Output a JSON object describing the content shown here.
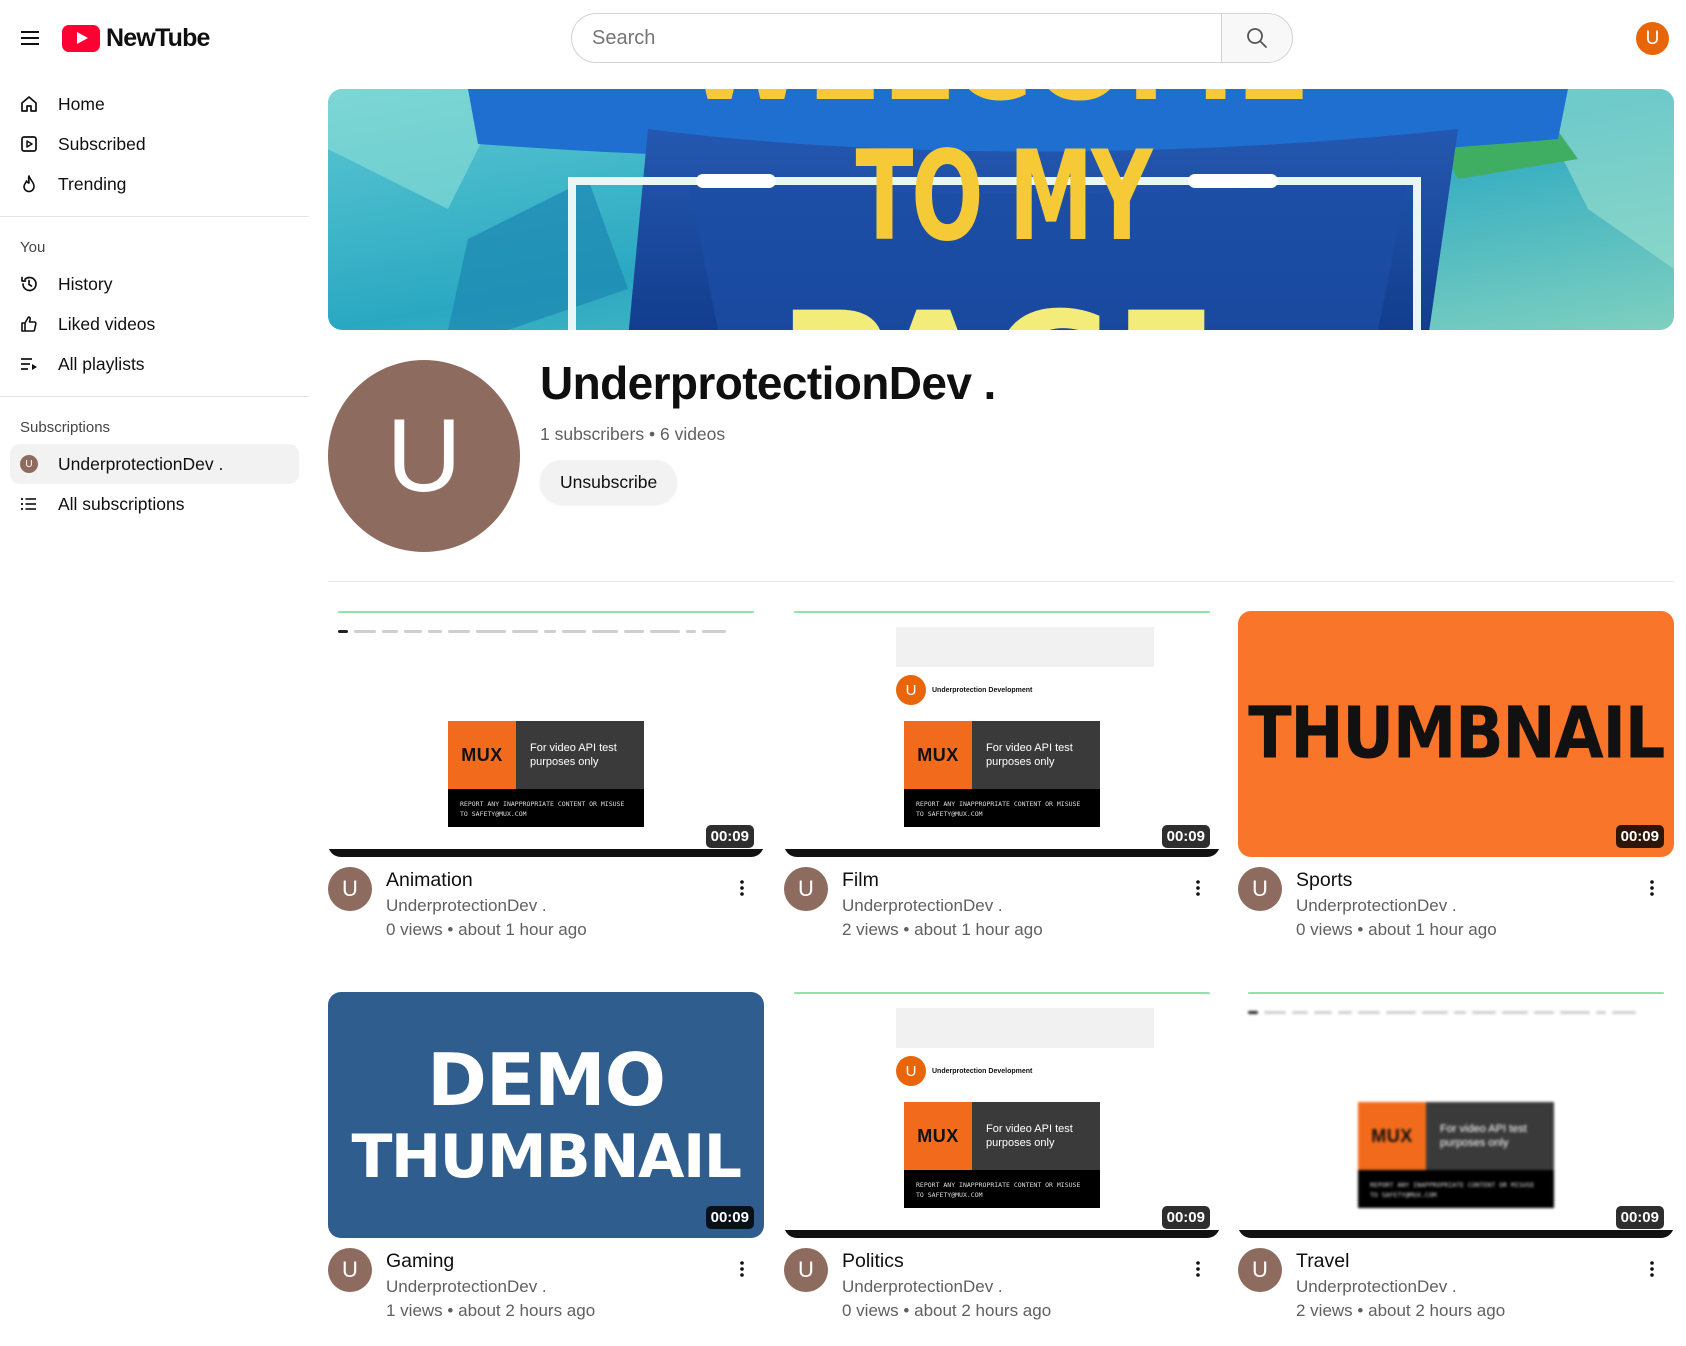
{
  "header": {
    "app_name": "NewTube",
    "search_placeholder": "Search",
    "user_initial": "U"
  },
  "sidebar": {
    "main": [
      {
        "label": "Home",
        "icon": "home-icon"
      },
      {
        "label": "Subscribed",
        "icon": "subscriptions-icon"
      },
      {
        "label": "Trending",
        "icon": "flame-icon"
      }
    ],
    "you_label": "You",
    "you": [
      {
        "label": "History",
        "icon": "history-icon"
      },
      {
        "label": "Liked videos",
        "icon": "thumbs-up-icon"
      },
      {
        "label": "All playlists",
        "icon": "playlist-icon"
      }
    ],
    "subs_label": "Subscriptions",
    "subs": [
      {
        "label": "UnderprotectionDev .",
        "initial": "U"
      },
      {
        "label": "All subscriptions",
        "icon": "list-icon"
      }
    ]
  },
  "banner": {
    "line1": "WELCOME",
    "line2": "TO MY",
    "line3": "PAGE"
  },
  "channel": {
    "initial": "U",
    "name": "UnderprotectionDev .",
    "subscribers": "1 subscribers",
    "videos": "6 videos",
    "separator": "•",
    "unsubscribe_label": "Unsubscribe"
  },
  "thumb_text": {
    "mux_logo": "MUX",
    "mux_line": "For video API test purposes only",
    "mux_report": "REPORT ANY INAPPROPRIATE CONTENT OR MISUSE TO SAFETY@MUX.COM",
    "ch_name": "Underprotection Development",
    "ch_initial": "U",
    "orange": "THUMBNAIL",
    "blue_line1": "DEMO",
    "blue_line2": "THUMBNAIL"
  },
  "videos": [
    {
      "title": "Animation",
      "channel": "UnderprotectionDev .",
      "views": "0 views",
      "time": "about 1 hour ago",
      "duration": "00:09",
      "initial": "U"
    },
    {
      "title": "Film",
      "channel": "UnderprotectionDev .",
      "views": "2 views",
      "time": "about 1 hour ago",
      "duration": "00:09",
      "initial": "U"
    },
    {
      "title": "Sports",
      "channel": "UnderprotectionDev .",
      "views": "0 views",
      "time": "about 1 hour ago",
      "duration": "00:09",
      "initial": "U"
    },
    {
      "title": "Gaming",
      "channel": "UnderprotectionDev .",
      "views": "1 views",
      "time": "about 2 hours ago",
      "duration": "00:09",
      "initial": "U"
    },
    {
      "title": "Politics",
      "channel": "UnderprotectionDev .",
      "views": "0 views",
      "time": "about 2 hours ago",
      "duration": "00:09",
      "initial": "U"
    },
    {
      "title": "Travel",
      "channel": "UnderprotectionDev .",
      "views": "2 views",
      "time": "about 2 hours ago",
      "duration": "00:09",
      "initial": "U"
    }
  ],
  "colors": {
    "brand": "#ff0033",
    "channel_avatar": "#8d6b5e",
    "user_avatar": "#e8650a"
  }
}
